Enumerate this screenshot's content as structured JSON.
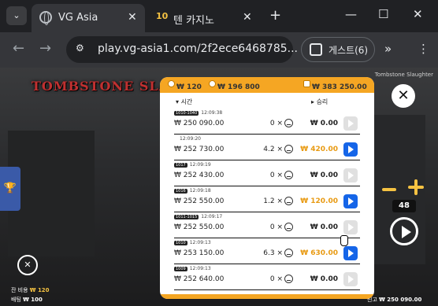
{
  "browser": {
    "tabs": [
      {
        "title": "VG Asia",
        "active": true
      },
      {
        "title": "텐 카지노",
        "active": false,
        "favicon_text": "10"
      }
    ],
    "url": "play.vg-asia1.com/2f2ece6468785...",
    "guest_label": "게스트(6)"
  },
  "game": {
    "logo_text": "TOMBSTONE SLAUGHTER",
    "title_small": "Tombstone Slaughter",
    "balance_label": "잔 비용",
    "balance_value": "₩ 120",
    "bet_label": "배팅",
    "bet_value": "₩ 100",
    "credit_label": "신고",
    "credit_value": "₩ 250 090.00",
    "bet_level": "48"
  },
  "history": {
    "header": {
      "balance": "₩ 120",
      "total": "₩ 196 800",
      "jackpot": "₩ 383 250.00"
    },
    "col_time": "시간",
    "col_win": "승리",
    "rows": [
      {
        "tag": "1010-1040",
        "time": "12:09:38",
        "balance": "₩ 250 090.00",
        "mult": "0 ×",
        "win": "₩ 0.00",
        "active": false
      },
      {
        "tag": "",
        "time": "12:09:20",
        "balance": "₩ 252 730.00",
        "mult": "4.2 ×",
        "win": "₩ 420.00",
        "active": true
      },
      {
        "tag": "1017",
        "time": "12:09:19",
        "balance": "₩ 252 430.00",
        "mult": "0 ×",
        "win": "₩ 0.00",
        "active": false
      },
      {
        "tag": "1016",
        "time": "12:09:18",
        "balance": "₩ 252 550.00",
        "mult": "1.2 ×",
        "win": "₩ 120.00",
        "active": true
      },
      {
        "tag": "1011-1015",
        "time": "12:09:17",
        "balance": "₩ 252 550.00",
        "mult": "0 ×",
        "win": "₩ 0.00",
        "active": false
      },
      {
        "tag": "1010",
        "time": "12:09:13",
        "balance": "₩ 253 150.00",
        "mult": "6.3 ×",
        "win": "₩ 630.00",
        "active": true
      },
      {
        "tag": "1009",
        "time": "12:09:13",
        "balance": "₩ 252 640.00",
        "mult": "0 ×",
        "win": "₩ 0.00",
        "active": false
      }
    ]
  },
  "colors": {
    "accent": "#f5a623",
    "button_blue": "#1565e8",
    "win_orange": "#e89a12"
  }
}
